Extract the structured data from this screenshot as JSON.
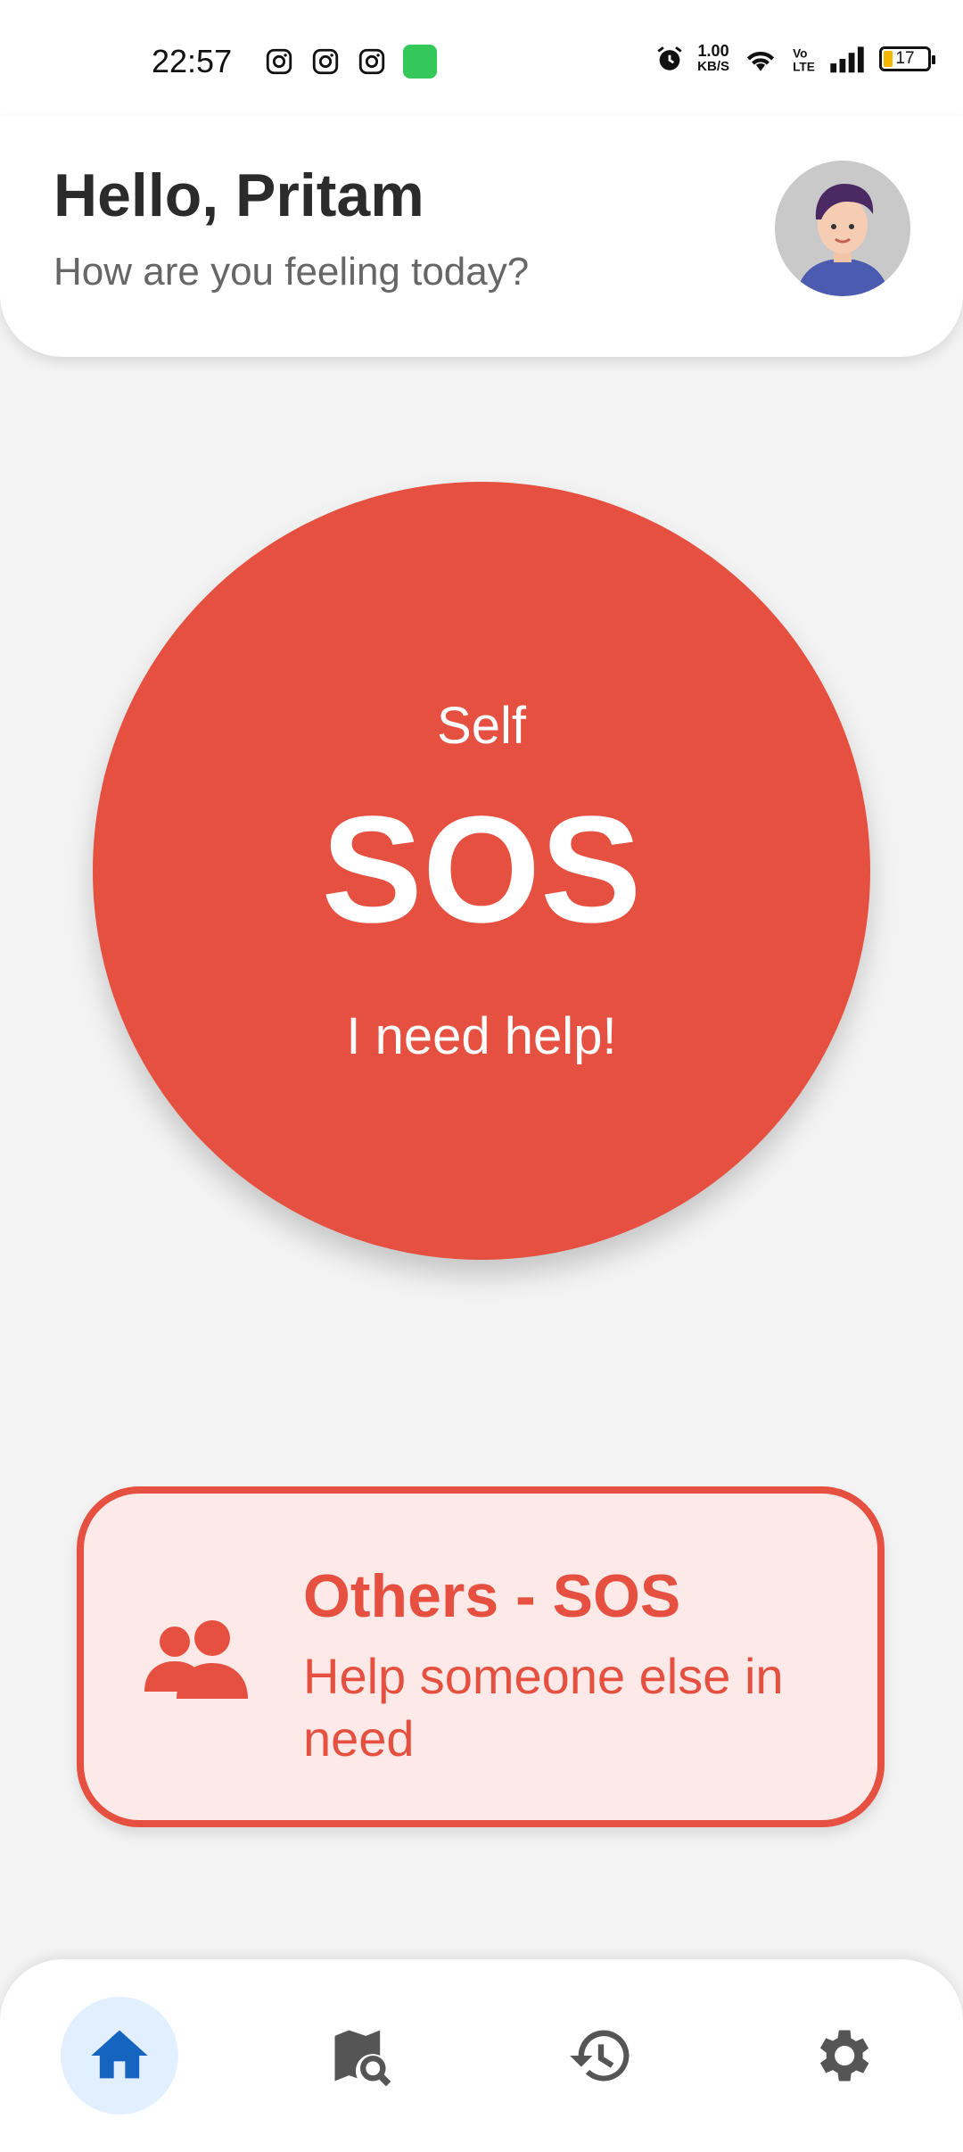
{
  "status_bar": {
    "time": "22:57",
    "net_speed_value": "1.00",
    "net_speed_unit": "KB/S",
    "battery_level": "17",
    "icons": [
      "instagram-icon",
      "instagram-icon",
      "instagram-icon",
      "app-badge-icon",
      "alarm-icon",
      "wifi-icon",
      "volte-icon",
      "signal-icon",
      "battery-icon"
    ]
  },
  "header": {
    "greeting": "Hello, Pritam",
    "subtitle": "How are you feeling today?",
    "avatar_icon": "user-avatar"
  },
  "sos": {
    "top_label": "Self",
    "main_label": "SOS",
    "bottom_label": "I need help!",
    "color": "#e55040"
  },
  "others_sos": {
    "title": "Others - SOS",
    "description": "Help someone else in need",
    "icon": "group-icon",
    "background": "#fde9e7",
    "accent": "#e55040"
  },
  "bottom_nav": {
    "items": [
      {
        "icon": "home-icon",
        "active": true
      },
      {
        "icon": "map-search-icon",
        "active": false
      },
      {
        "icon": "history-icon",
        "active": false
      },
      {
        "icon": "settings-gear-icon",
        "active": false
      }
    ],
    "active_color": "#1565c0",
    "inactive_color": "#555555"
  }
}
